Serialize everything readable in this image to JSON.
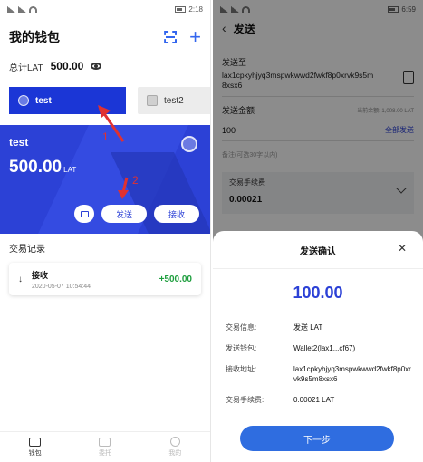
{
  "left": {
    "status": {
      "left": "⁴ᴳ.ıl ⁴ᴳ.ıl ≋ ⧗",
      "right": "⏰ ▣ 2:18"
    },
    "title": "我的钱包",
    "total_label": "总计LAT",
    "total_value": "500.00",
    "tabs": [
      {
        "label": "test"
      },
      {
        "label": "test2"
      }
    ],
    "card": {
      "name": "test",
      "balance": "500.00",
      "unit": "LAT",
      "send_label": "发送",
      "receive_label": "接收"
    },
    "annotations": {
      "one": "1",
      "two": "2"
    },
    "history_title": "交易记录",
    "transactions": [
      {
        "type": "接收",
        "time": "2020-05-07 10:54:44",
        "amount": "+500.00"
      }
    ],
    "nav": [
      {
        "label": "钱包"
      },
      {
        "label": "委托"
      },
      {
        "label": "我的"
      }
    ]
  },
  "right": {
    "status": {
      "left": "⁴ᴳ.ıl ⁴ᴳ.ıl ≋ ▣",
      "right": "⏰ ▣ 6:59"
    },
    "title": "发送",
    "send_to_label": "发送至",
    "send_to_value": "lax1cpkyhjyq3mspwkwwd2fwkf8p0xrvk9s5m8xsx6",
    "amount_label": "发送金额",
    "available_hint": "当前余额: 1,008.00 LAT",
    "amount_value": "100",
    "send_all": "全部发送",
    "remark": "备注(可选30字以内)",
    "fee_label": "交易手续费",
    "fee_value": "0.00021",
    "sheet": {
      "title": "发送确认",
      "amount": "100.00",
      "rows": [
        {
          "label": "交易信息:",
          "value": "发送 LAT"
        },
        {
          "label": "发送钱包:",
          "value": "Wallet2(lax1...cf67)"
        },
        {
          "label": "接收地址:",
          "value": "lax1cpkyhjyq3mspwkwwd2fwkf8p0xrvk9s5m8xsx6"
        },
        {
          "label": "交易手续费:",
          "value": "0.00021 LAT"
        }
      ],
      "next_label": "下一步"
    }
  },
  "colors": {
    "primary": "#2c41d6",
    "tab_active": "#1b36d6",
    "green": "#1e9e3e",
    "annotation": "#e03131",
    "button": "#2f6de0"
  }
}
